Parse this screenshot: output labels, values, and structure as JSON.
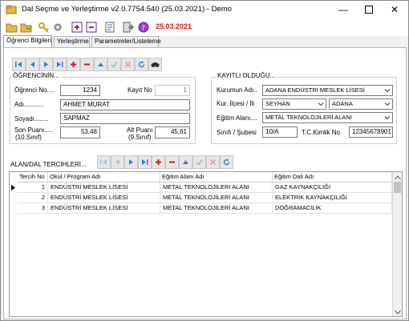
{
  "app": {
    "title": "Dal Seçme ve Yerleştirme v2.0.7754.540 (25.03.2021) - Demo",
    "date": "25.03.2021"
  },
  "tabs": [
    {
      "label": "Öğrenci Bilgileri"
    },
    {
      "label": "Yerleştirme"
    },
    {
      "label": "Parametreler/Listeleme"
    }
  ],
  "student": {
    "group_title": "ÖĞRENCİNİN...",
    "no_label": "Öğrenci No....",
    "no_value": "1234",
    "record_label": "Kayıt No",
    "record_value": "1",
    "name_label": "Adı...........",
    "name_value": "AHMET MURAT",
    "surname_label": "Soyadı........",
    "surname_value": "SAPMAZ",
    "last_score_label": "Son Puanı.....",
    "last_score_sub": "(10.Sınıf)",
    "last_score_value": "53,48",
    "base_score_label": "Alt Puanı",
    "base_score_sub": "(9.Sınıf)",
    "base_score_value": "45,61"
  },
  "registered": {
    "group_title": "KAYITLI OLDUĞU...",
    "institution_label": "Kurumun Adı..",
    "institution_value": "ADANA ENDÜSTRİ MESLEK LİSESİ",
    "district_label": "Kur. İlçesi / İli",
    "district_value": "SEYHAN",
    "province_value": "ADANA",
    "field_label": "Eğitim Alanı....",
    "field_value": "METAL TEKNOLOJİLERİ ALANI",
    "class_label": "Sınıfı / Şubesi",
    "class_value": "10/A",
    "id_label": "T.C.Kimlik No",
    "id_value": "12345678901"
  },
  "preferences": {
    "title": "ALAN/DAL TERCİHLERİ...",
    "columns": [
      "Tercih No",
      "Okul / Program Adı",
      "Eğitim Alanı Adı",
      "Eğitim Dalı Adı"
    ],
    "rows": [
      {
        "no": "1",
        "school": "ENDÜSTRİ MESLEK LİSESİ",
        "field": "METAL TEKNOLOJİLERİ ALANI",
        "branch": "GAZ KAYNAKÇILIĞI"
      },
      {
        "no": "2",
        "school": "ENDÜSTRİ MESLEK LİSESİ",
        "field": "METAL TEKNOLOJİLERİ ALANI",
        "branch": "ELEKTRİK KAYNAKÇILIĞI"
      },
      {
        "no": "3",
        "school": "ENDÜSTRİ MESLEK LİSESİ",
        "field": "METAL TEKNOLOJİLERİ ALANI",
        "branch": "DOĞRAMACILIK"
      }
    ]
  },
  "colors": {
    "accent": "#1a73c8",
    "danger": "#d6161a",
    "navBlue": "#2d7fd6"
  }
}
